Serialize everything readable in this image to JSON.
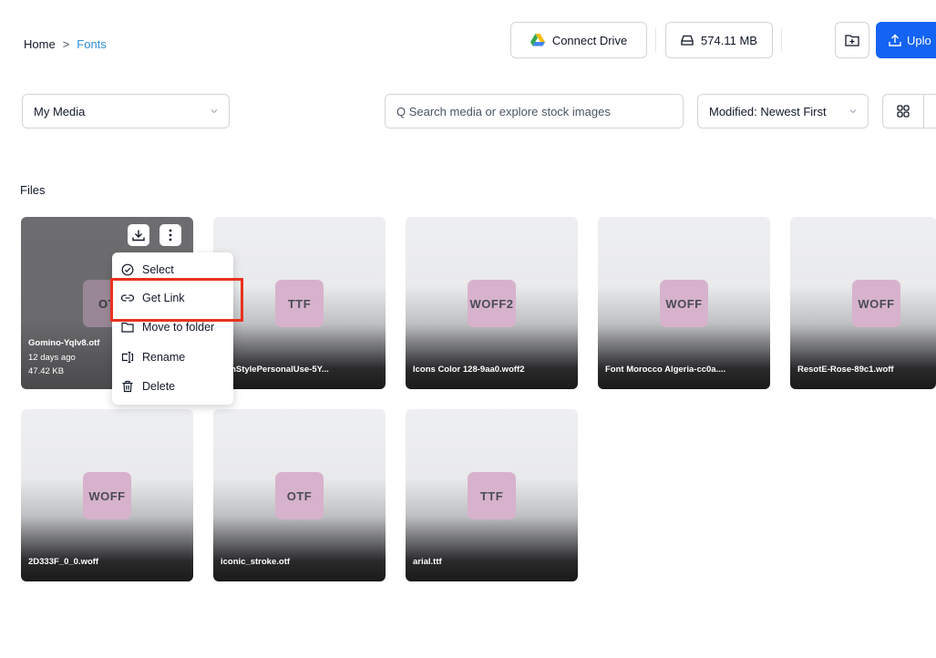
{
  "breadcrumb": {
    "home": "Home",
    "separator": ">",
    "current": "Fonts"
  },
  "header": {
    "connect_drive": "Connect Drive",
    "storage": "574.11 MB",
    "upload": "Uplo"
  },
  "filters": {
    "media_select": "My Media",
    "search_placeholder": "Q Search media or explore stock images",
    "sort_select": "Modified: Newest First"
  },
  "section": {
    "title": "Files"
  },
  "files": [
    {
      "badge": "OT",
      "name": "Gomino-Yqlv8.otf",
      "modified": "12 days ago",
      "size": "47.42 KB"
    },
    {
      "badge": "TTF",
      "name": "ganStylePersonalUse-5Y..."
    },
    {
      "badge": "WOFF2",
      "name": "Icons Color 128-9aa0.woff2"
    },
    {
      "badge": "WOFF",
      "name": "Font Morocco Algeria-cc0a...."
    },
    {
      "badge": "WOFF",
      "name": "ResotE-Rose-89c1.woff"
    },
    {
      "badge": "WOFF",
      "name": "2D333F_0_0.woff"
    },
    {
      "badge": "OTF",
      "name": "iconic_stroke.otf"
    },
    {
      "badge": "TTF",
      "name": "arial.ttf"
    }
  ],
  "context_menu": {
    "select": "Select",
    "get_link": "Get Link",
    "move_to_folder": "Move to folder",
    "rename": "Rename",
    "delete": "Delete"
  },
  "colors": {
    "accent": "#1463f3",
    "link": "#2f8fd8",
    "highlight": "#e8321e",
    "badge": "#d7b2cc"
  }
}
